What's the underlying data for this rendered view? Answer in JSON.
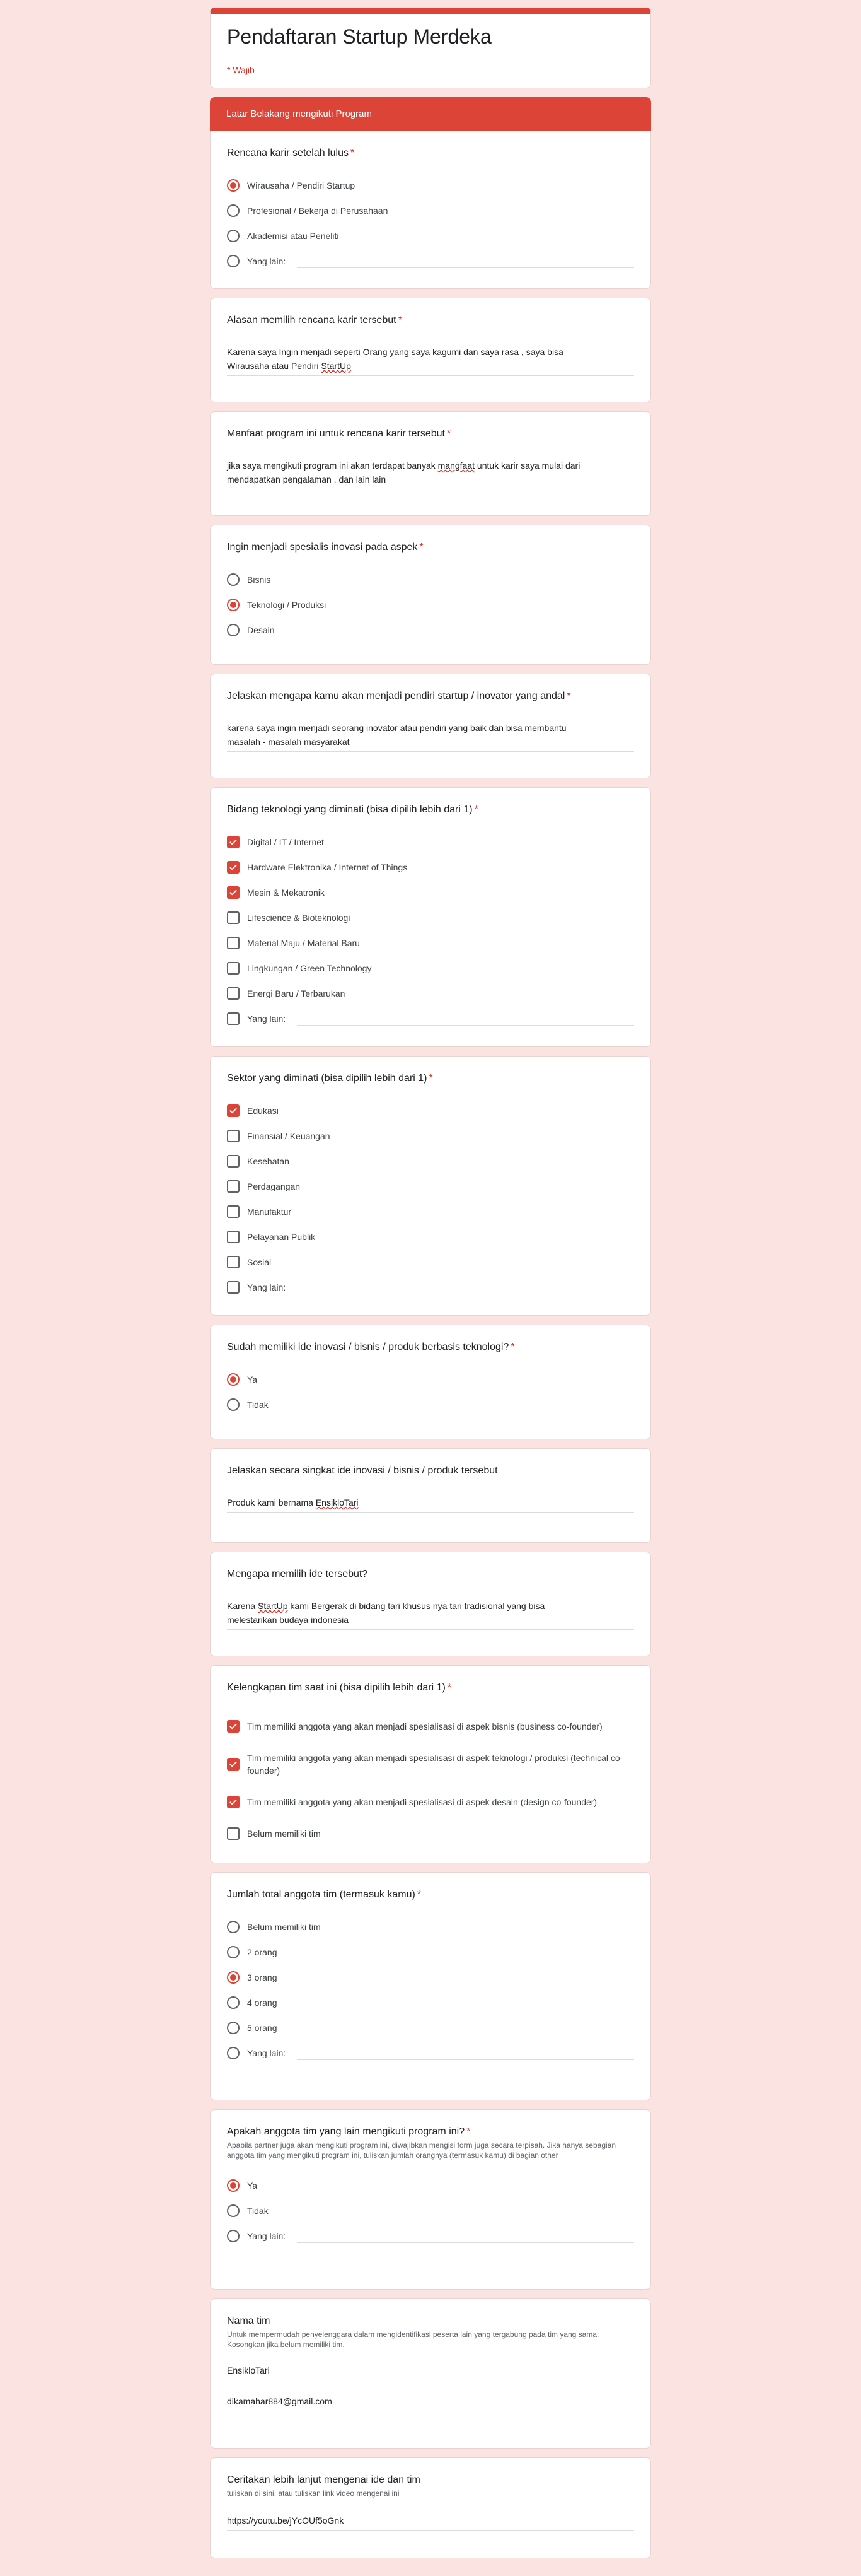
{
  "form": {
    "title": "Pendaftaran Startup Merdeka",
    "required_note": "* Wajib"
  },
  "section": {
    "title": "Latar Belakang mengikuti Program"
  },
  "q1": {
    "label": "Rencana karir setelah lulus",
    "options": [
      "Wirausaha / Pendiri Startup",
      "Profesional / Bekerja di Perusahaan",
      "Akademisi atau Peneliti",
      "Yang lain:"
    ],
    "selected": "Wirausaha / Pendiri Startup"
  },
  "q2": {
    "label": "Alasan memilih rencana karir tersebut",
    "answer_line1": "Karena saya Ingin menjadi seperti Orang yang saya kagumi dan saya rasa , saya bisa",
    "answer_line2_a": "Wirausaha atau Pendiri ",
    "answer_line2_b": "StartUp"
  },
  "q3": {
    "label": "Manfaat program ini untuk rencana karir tersebut",
    "answer_a": "jika saya mengikuti program ini akan terdapat banyak ",
    "answer_b": "mangfaat",
    "answer_c": " untuk karir saya mulai dari",
    "answer_line2": "mendapatkan pengalaman , dan lain lain"
  },
  "q4": {
    "label": "Ingin menjadi spesialis inovasi pada aspek",
    "options": [
      "Bisnis",
      "Teknologi / Produksi",
      "Desain"
    ],
    "selected": "Teknologi / Produksi"
  },
  "q5": {
    "label": "Jelaskan mengapa kamu akan menjadi pendiri startup / inovator yang andal",
    "answer_line1": "karena saya ingin menjadi seorang inovator atau pendiri yang baik dan bisa membantu",
    "answer_line2": "masalah - masalah masyarakat"
  },
  "q6": {
    "label": "Bidang teknologi yang diminati (bisa dipilih lebih dari 1)",
    "options": [
      "Digital / IT / Internet",
      "Hardware Elektronika / Internet of Things",
      "Mesin & Mekatronik",
      "Lifescience & Bioteknologi",
      "Material Maju / Material Baru",
      "Lingkungan / Green Technology",
      "Energi Baru / Terbarukan",
      "Yang lain:"
    ],
    "checked": [
      true,
      true,
      true,
      false,
      false,
      false,
      false,
      false
    ]
  },
  "q7": {
    "label": "Sektor yang diminati (bisa dipilih lebih dari 1)",
    "options": [
      "Edukasi",
      "Finansial / Keuangan",
      "Kesehatan",
      "Perdagangan",
      "Manufaktur",
      "Pelayanan Publik",
      "Sosial",
      "Yang lain:"
    ],
    "checked": [
      true,
      false,
      false,
      false,
      false,
      false,
      false,
      false
    ]
  },
  "q8": {
    "label": "Sudah memiliki ide inovasi / bisnis / produk berbasis teknologi?",
    "options": [
      "Ya",
      "Tidak"
    ],
    "selected": "Ya"
  },
  "q9": {
    "label": "Jelaskan secara singkat ide inovasi / bisnis / produk tersebut",
    "answer_a": "Produk kami bernama ",
    "answer_b": "EnsikloTari"
  },
  "q10": {
    "label": "Mengapa memilih ide tersebut?",
    "answer_a": "Karena ",
    "answer_b": "StartUp",
    "answer_c": " kami Bergerak di bidang tari khusus nya tari tradisional yang bisa",
    "answer_line2": "melestarikan budaya indonesia"
  },
  "q11": {
    "label": "Kelengkapan tim saat ini (bisa dipilih lebih dari 1)",
    "options": [
      "Tim memiliki anggota yang akan menjadi spesialisasi di aspek bisnis (business co-founder)",
      "Tim memiliki anggota yang akan menjadi spesialisasi di aspek teknologi / produksi (technical co-founder)",
      "Tim memiliki anggota yang akan menjadi spesialisasi di aspek desain (design co-founder)",
      "Belum memiliki tim"
    ],
    "checked": [
      true,
      true,
      true,
      false
    ]
  },
  "q12": {
    "label": "Jumlah total anggota tim (termasuk kamu)",
    "options": [
      "Belum memiliki tim",
      "2 orang",
      "3 orang",
      "4 orang",
      "5 orang",
      "Yang lain:"
    ],
    "selected": "3 orang"
  },
  "q13": {
    "label": "Apakah anggota tim yang lain mengikuti program ini?",
    "helper": "Apabila partner juga akan mengikuti program ini, diwajibkan mengisi form juga secara terpisah. Jika hanya sebagian anggota tim yang mengikuti program ini, tuliskan jumlah orangnya (termasuk kamu) di bagian other",
    "options": [
      "Ya",
      "Tidak",
      "Yang lain:"
    ],
    "selected": "Ya"
  },
  "q14": {
    "label": "Nama tim",
    "helper": "Untuk mempermudah penyelenggara dalam mengidentifikasi peserta lain yang tergabung pada tim yang sama. Kosongkan jika belum memiliki tim.",
    "answer1": "EnsikloTari",
    "answer2": "dikamahar884@gmail.com"
  },
  "q15": {
    "label": "Ceritakan lebih lanjut mengenai ide dan tim",
    "helper": "tuliskan di sini, atau tuliskan link video mengenai ini",
    "answer": "https://youtu.be/jYcOUf5oGnk"
  },
  "colors": {
    "accent": "#db4437",
    "background": "#fbe3e1"
  }
}
